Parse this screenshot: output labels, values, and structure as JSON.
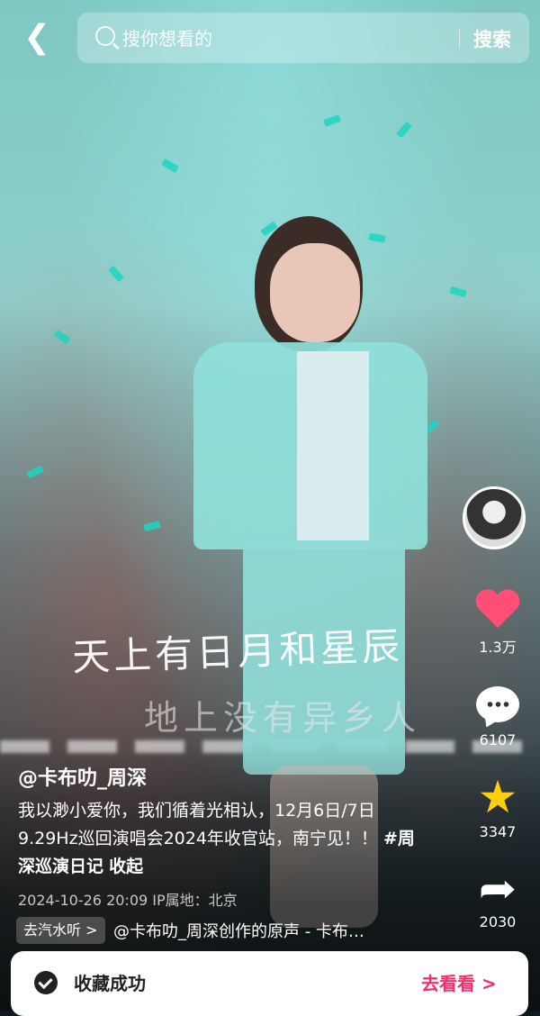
{
  "search": {
    "placeholder": "搜你想看的",
    "button": "搜索"
  },
  "video": {
    "overlay_line1": "天上有日月和星辰",
    "overlay_line2": "地上没有异乡人"
  },
  "rail": {
    "likes": "1.3万",
    "comments": "6107",
    "favorites": "3347",
    "shares": "2030"
  },
  "post": {
    "author": "@卡布叻_周深",
    "description": "我以渺小爱你，我们循着光相认，12月6日/7日9.29Hz巡回演唱会2024年收官站，南宁见！！",
    "hashtag": "#周深巡演日记",
    "fold": "收起",
    "meta": "2024-10-26 20:09  IP属地：北京",
    "music_chip": "去汽水听 >",
    "music_text": "@卡布叻_周深创作的原声 - 卡布…"
  },
  "toast": {
    "text": "收藏成功",
    "link": "去看看 >"
  },
  "colors": {
    "like": "#ff4f74",
    "star": "#ffcf0f",
    "toast_link": "#f0306a"
  },
  "icons": [
    "back-icon",
    "search-icon",
    "heart-icon",
    "comment-icon",
    "star-icon",
    "share-icon",
    "check-icon"
  ]
}
